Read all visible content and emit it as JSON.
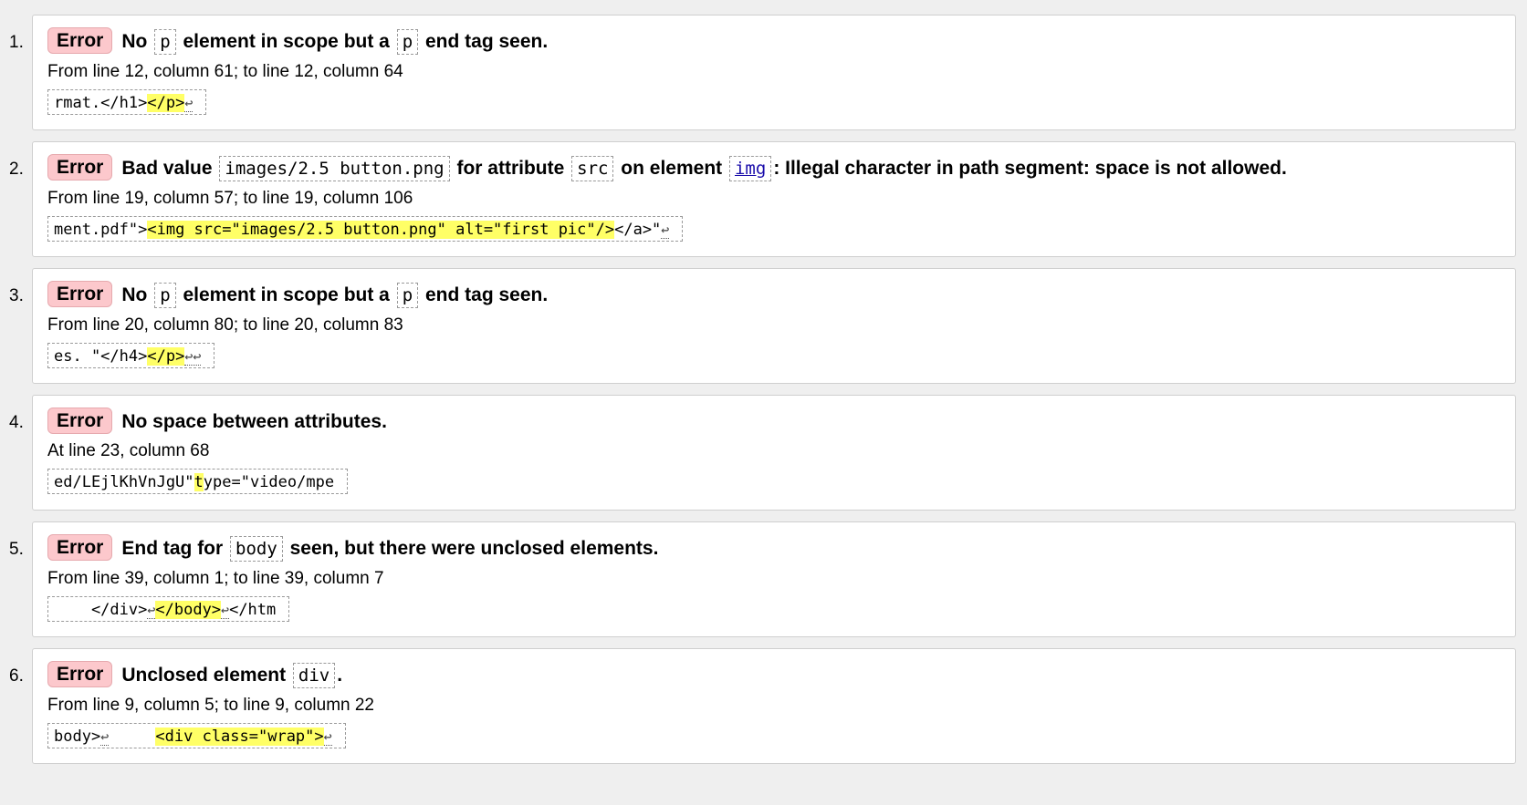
{
  "messages": [
    {
      "number": "1.",
      "type": "Error",
      "parts": [
        {
          "t": "No "
        },
        {
          "code": "p"
        },
        {
          "t": " element in scope but a "
        },
        {
          "code": "p"
        },
        {
          "t": " end tag seen."
        }
      ],
      "location": "From line 12, column 61; to line 12, column 64",
      "extract": [
        {
          "t": "rmat.</h1>"
        },
        {
          "hl": "</p>"
        },
        {
          "lf": "↩"
        }
      ]
    },
    {
      "number": "2.",
      "type": "Error",
      "parts": [
        {
          "t": "Bad value "
        },
        {
          "code": "images/2.5 button.png"
        },
        {
          "t": " for attribute "
        },
        {
          "code": "src"
        },
        {
          "t": " on element "
        },
        {
          "link": "img"
        },
        {
          "t": ": Illegal character in path segment: space is not allowed."
        }
      ],
      "location": "From line 19, column 57; to line 19, column 106",
      "extract": [
        {
          "t": "ment.pdf\">"
        },
        {
          "hl": "<img src=\"images/2.5 button.png\" alt=\"first pic\"/>"
        },
        {
          "t": "</a>\""
        },
        {
          "lf": "↩"
        }
      ]
    },
    {
      "number": "3.",
      "type": "Error",
      "parts": [
        {
          "t": "No "
        },
        {
          "code": "p"
        },
        {
          "t": " element in scope but a "
        },
        {
          "code": "p"
        },
        {
          "t": " end tag seen."
        }
      ],
      "location": "From line 20, column 80; to line 20, column 83",
      "extract": [
        {
          "t": "es. \"</h4>"
        },
        {
          "hl": "</p>"
        },
        {
          "lf": "↩↩"
        }
      ]
    },
    {
      "number": "4.",
      "type": "Error",
      "parts": [
        {
          "t": "No space between attributes."
        }
      ],
      "location": "At line 23, column 68",
      "extract": [
        {
          "t": "ed/LEjlKhVnJgU\""
        },
        {
          "hl": "t"
        },
        {
          "t": "ype=\"video/mpe"
        }
      ]
    },
    {
      "number": "5.",
      "type": "Error",
      "parts": [
        {
          "t": "End tag for "
        },
        {
          "code": "body"
        },
        {
          "t": " seen, but there were unclosed elements."
        }
      ],
      "location": "From line 39, column 1; to line 39, column 7",
      "extract": [
        {
          "t": "    </div>"
        },
        {
          "lf": "↩"
        },
        {
          "hl": "</body>"
        },
        {
          "lf": "↩"
        },
        {
          "t": "</htm"
        }
      ]
    },
    {
      "number": "6.",
      "type": "Error",
      "parts": [
        {
          "t": "Unclosed element "
        },
        {
          "code": "div"
        },
        {
          "t": "."
        }
      ],
      "location": "From line 9, column 5; to line 9, column 22",
      "extract": [
        {
          "t": "body>"
        },
        {
          "lf": "↩"
        },
        {
          "t": "     "
        },
        {
          "hl": "<div class=\"wrap\">"
        },
        {
          "lf": "↩"
        }
      ]
    }
  ],
  "colors": {
    "error_badge_bg": "#fcc8cc",
    "highlight": "#ffff66",
    "link": "#1a0dab",
    "page_bg": "#efefef"
  }
}
